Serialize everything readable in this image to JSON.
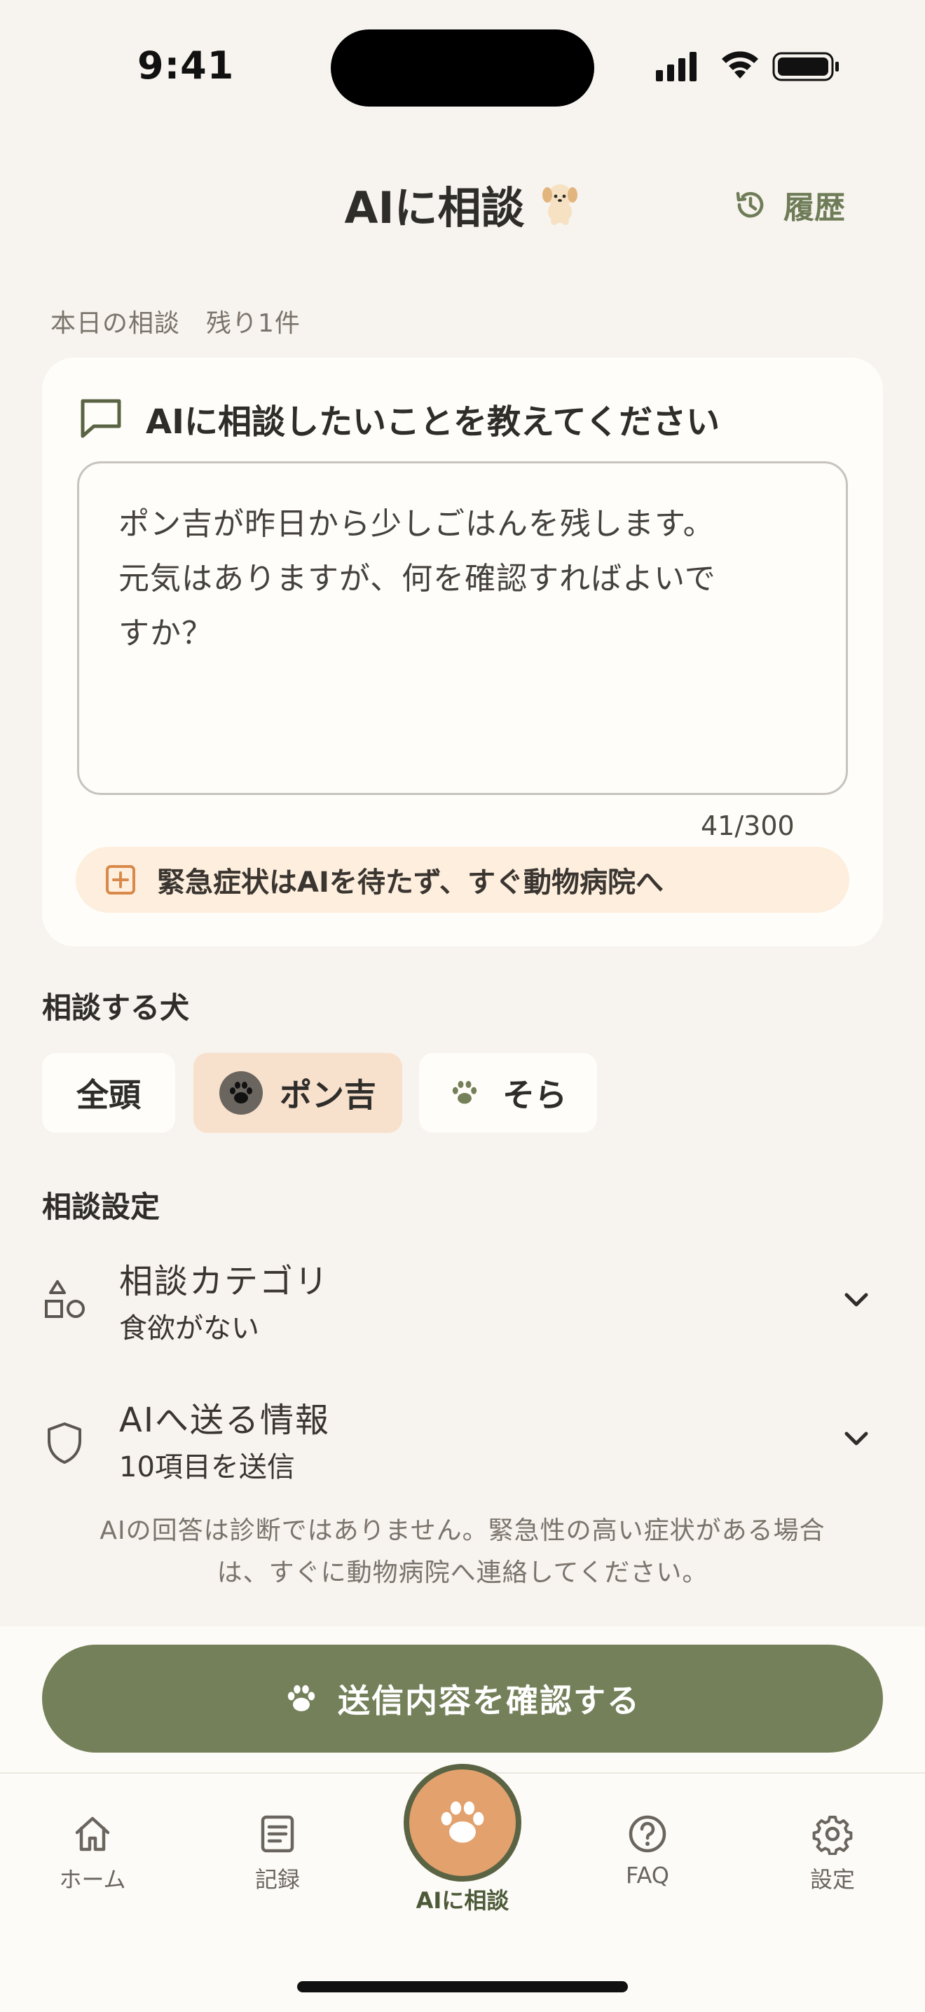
{
  "status_bar": {
    "time": "9:41"
  },
  "header": {
    "title": "AIに相談",
    "history_label": "履歴"
  },
  "remaining": "本日の相談　残り1件",
  "consult_card": {
    "heading": "AIに相談したいことを教えてください",
    "message_lines": [
      "ポン吉が昨日から少しごはんを残します。",
      "元気はありますが、何を確認すればよいで",
      "すか？"
    ],
    "char_count": "41/300",
    "emergency_notice": "緊急症状はAIを待たず、すぐ動物病院へ"
  },
  "dog_select": {
    "label": "相談する犬",
    "chips": [
      {
        "label": "全頭",
        "selected": false
      },
      {
        "label": "ポン吉",
        "selected": true
      },
      {
        "label": "そら",
        "selected": false
      }
    ]
  },
  "settings": {
    "label": "相談設定",
    "category": {
      "title": "相談カテゴリ",
      "value": "食欲がない"
    },
    "info": {
      "title": "AIへ送る情報",
      "value": "10項目を送信"
    }
  },
  "disclaimer_lines": [
    "AIの回答は診断ではありません。緊急性の高い症状がある場合",
    "は、すぐに動物病院へ連絡してください。"
  ],
  "cta_label": "送信内容を確認する",
  "bottom_nav": {
    "home": "ホーム",
    "records": "記録",
    "ai": "AIに相談",
    "faq": "FAQ",
    "settings": "設定"
  },
  "colors": {
    "background": "#f7f3ee",
    "accent_green": "#748059",
    "accent_orange": "#e2a16d",
    "notice_bg": "#fdeedd"
  }
}
